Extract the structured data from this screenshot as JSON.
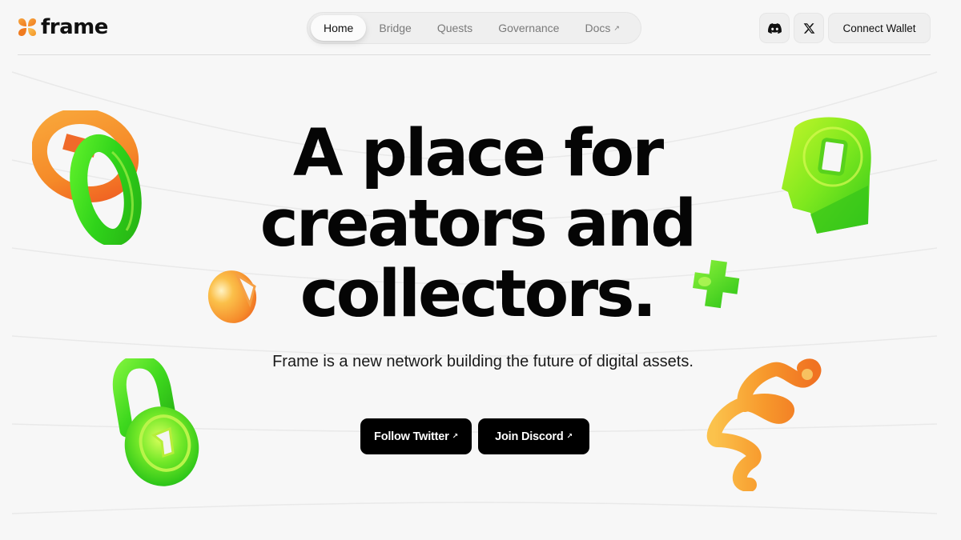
{
  "brand": {
    "name": "frame",
    "logo_icon": "four-petal-flower-icon",
    "colors": {
      "orange": "#f5922a",
      "orange_light": "#f9b54a",
      "green": "#3fd61e",
      "lime": "#a6ef1c",
      "black": "#000000",
      "background": "#f7f7f7"
    }
  },
  "nav": {
    "items": [
      {
        "label": "Home",
        "active": true
      },
      {
        "label": "Bridge",
        "active": false
      },
      {
        "label": "Quests",
        "active": false
      },
      {
        "label": "Governance",
        "active": false
      },
      {
        "label": "Docs",
        "active": false,
        "external_icon": "↗"
      }
    ]
  },
  "header_actions": {
    "discord_icon": "discord-icon",
    "x_icon": "x-logo-icon",
    "connect_wallet_label": "Connect Wallet"
  },
  "hero": {
    "title_lines": [
      "A place for",
      "creators and",
      "collectors."
    ],
    "subtitle": "Frame is a new network building the future of digital assets.",
    "cta_twitter": "Follow Twitter",
    "cta_discord": "Join Discord",
    "external_arrow": "↗"
  },
  "decorations": [
    "interlocked-rings-icon",
    "orange-egg-icon",
    "green-padlock-icon",
    "green-head-icon",
    "green-cross-icon",
    "orange-spring-icon"
  ]
}
